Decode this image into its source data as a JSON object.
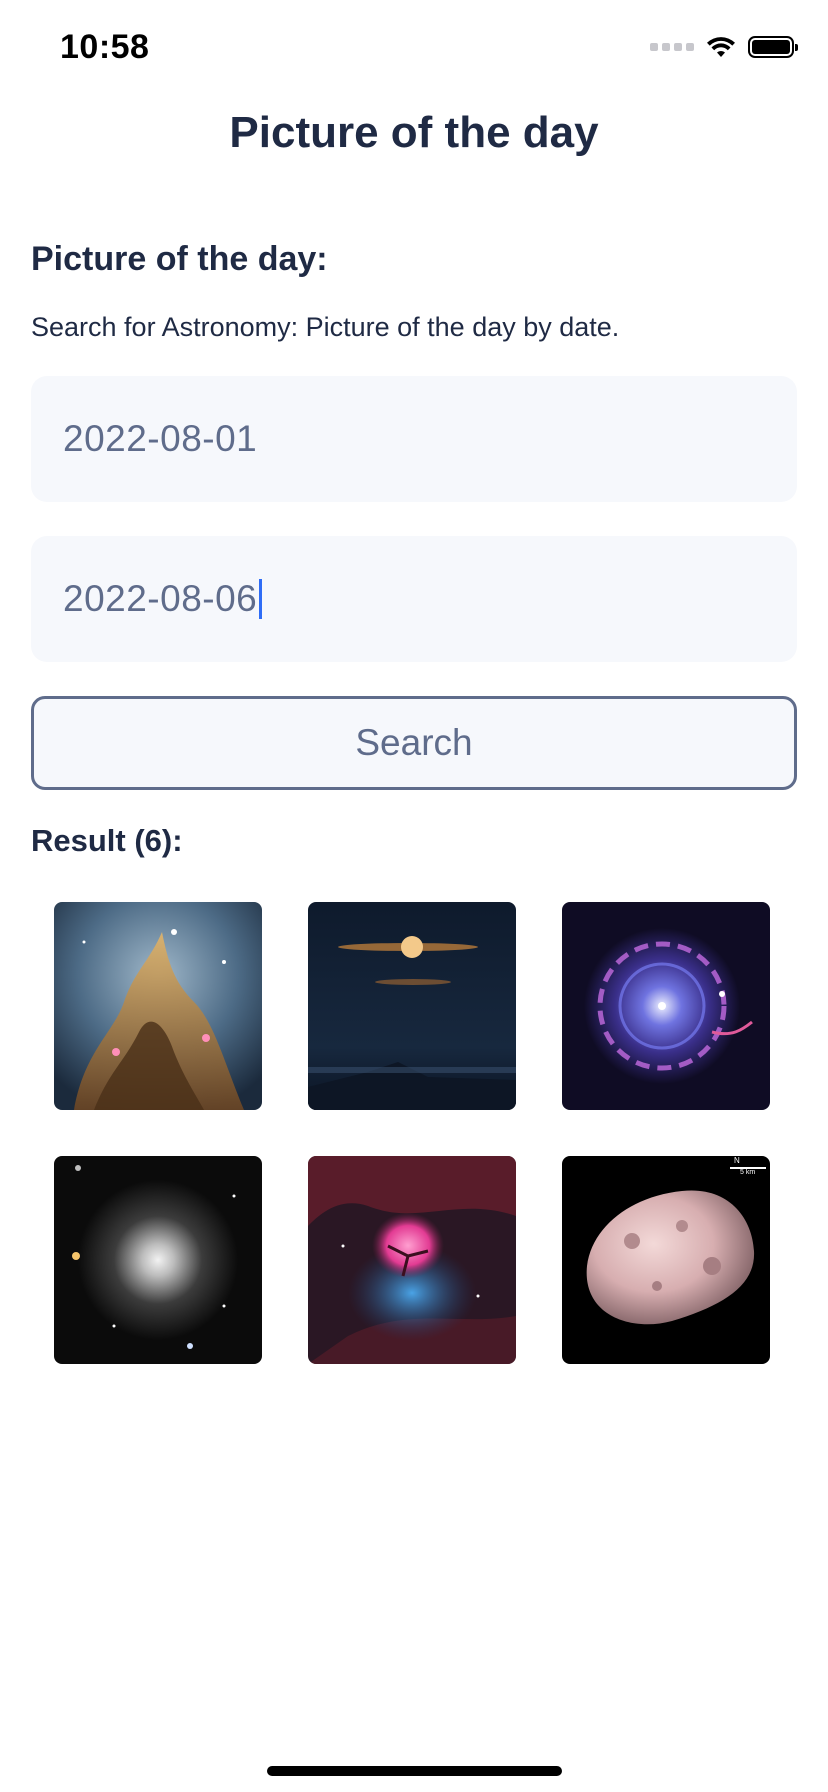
{
  "status": {
    "time": "10:58",
    "icons": [
      "cellular-signal-icon",
      "wifi-icon",
      "battery-icon"
    ]
  },
  "nav": {
    "title": "Picture of the day"
  },
  "form": {
    "heading": "Picture of the day:",
    "subtitle": "Search for Astronomy: Picture of the day by date.",
    "start_date": "2022-08-01",
    "end_date": "2022-08-06",
    "search_label": "Search"
  },
  "results": {
    "label": "Result (6):",
    "items": [
      {
        "name": "nebula-pillars-photo"
      },
      {
        "name": "moon-over-landscape-photo"
      },
      {
        "name": "planetary-nebula-photo"
      },
      {
        "name": "globular-cluster-photo"
      },
      {
        "name": "trifid-nebula-photo"
      },
      {
        "name": "phobos-moon-photo",
        "scale_label": "5 km",
        "north_label": "N"
      }
    ]
  },
  "colors": {
    "text": "#1f2a44",
    "muted": "#5f6c8b",
    "field_bg": "#f6f8fc",
    "caret": "#2f6df6"
  }
}
